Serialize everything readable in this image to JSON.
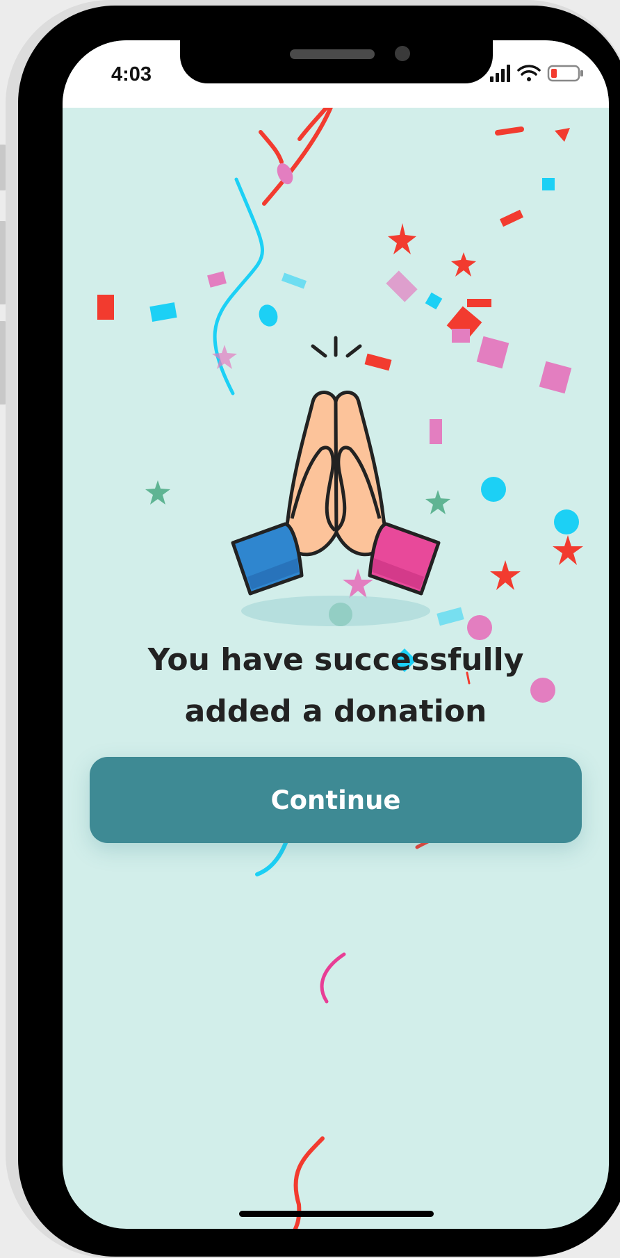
{
  "status_bar": {
    "time": "4:03"
  },
  "success": {
    "line1": "You have successfully",
    "line2": "added a donation",
    "illustration_icon": "praying-hands-icon"
  },
  "actions": {
    "continue_label": "Continue"
  },
  "colors": {
    "background": "#d2eeea",
    "button": "#3e8a94",
    "button_text": "#ffffff",
    "heading": "#222222",
    "confetti_red": "#f23b2f",
    "confetti_cyan": "#1cd0f5",
    "confetti_pink": "#e37ec0",
    "confetti_green": "#5fb493",
    "sleeve_left": "#2f86cf",
    "sleeve_right": "#e8499a",
    "skin": "#fcc39a"
  }
}
